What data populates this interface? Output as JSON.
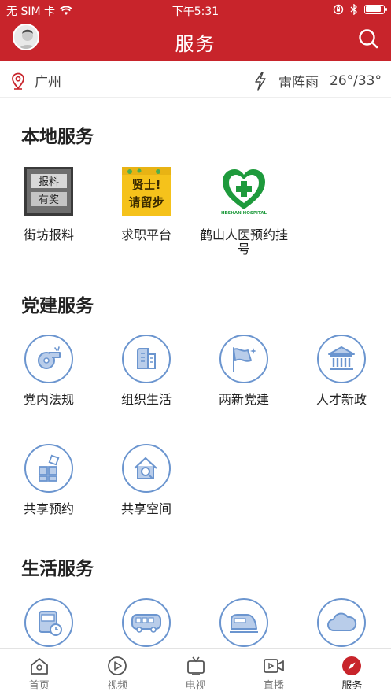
{
  "status_bar": {
    "carrier": "无 SIM 卡",
    "time": "下午5:31"
  },
  "header": {
    "title": "服务",
    "avatar_icon": "user-avatar",
    "search_icon": "search-icon"
  },
  "location_bar": {
    "city": "广州",
    "weather": "雷阵雨",
    "temperature": "26°/33°"
  },
  "sections": {
    "local": {
      "title": "本地服务",
      "items": [
        {
          "label": "街坊报料",
          "icon": "baoliao-image",
          "badge_lines": [
            "报料",
            "有奖"
          ]
        },
        {
          "label": "求职平台",
          "icon": "job-platform-image",
          "badge_lines": [
            "贤士!",
            "请留步"
          ]
        },
        {
          "label": "鹤山人医预约挂号",
          "icon": "hospital-logo",
          "badge_lines": [
            "HESHAN HOSPITAL"
          ]
        }
      ]
    },
    "party": {
      "title": "党建服务",
      "items": [
        {
          "label": "党内法规",
          "icon": "whistle-icon"
        },
        {
          "label": "组织生活",
          "icon": "building-icon"
        },
        {
          "label": "两新党建",
          "icon": "flag-icon"
        },
        {
          "label": "人才新政",
          "icon": "government-icon"
        },
        {
          "label": "共享预约",
          "icon": "blocks-icon"
        },
        {
          "label": "共享空间",
          "icon": "home-search-icon"
        }
      ]
    },
    "life": {
      "title": "生活服务",
      "items": [
        {
          "icon": "bus-schedule-icon"
        },
        {
          "icon": "coach-icon"
        },
        {
          "icon": "train-icon"
        },
        {
          "icon": "cloud-icon"
        }
      ]
    }
  },
  "tabbar": {
    "tabs": [
      {
        "label": "首页",
        "icon": "home-icon"
      },
      {
        "label": "视频",
        "icon": "play-icon"
      },
      {
        "label": "电视",
        "icon": "tv-icon"
      },
      {
        "label": "直播",
        "icon": "live-camera-icon"
      },
      {
        "label": "服务",
        "icon": "compass-icon",
        "active": true
      }
    ]
  },
  "colors": {
    "brand_red": "#c8242b",
    "icon_blue": "#6b95cf",
    "icon_fill": "#b9cdea",
    "hospital_green": "#1e9a3c"
  }
}
